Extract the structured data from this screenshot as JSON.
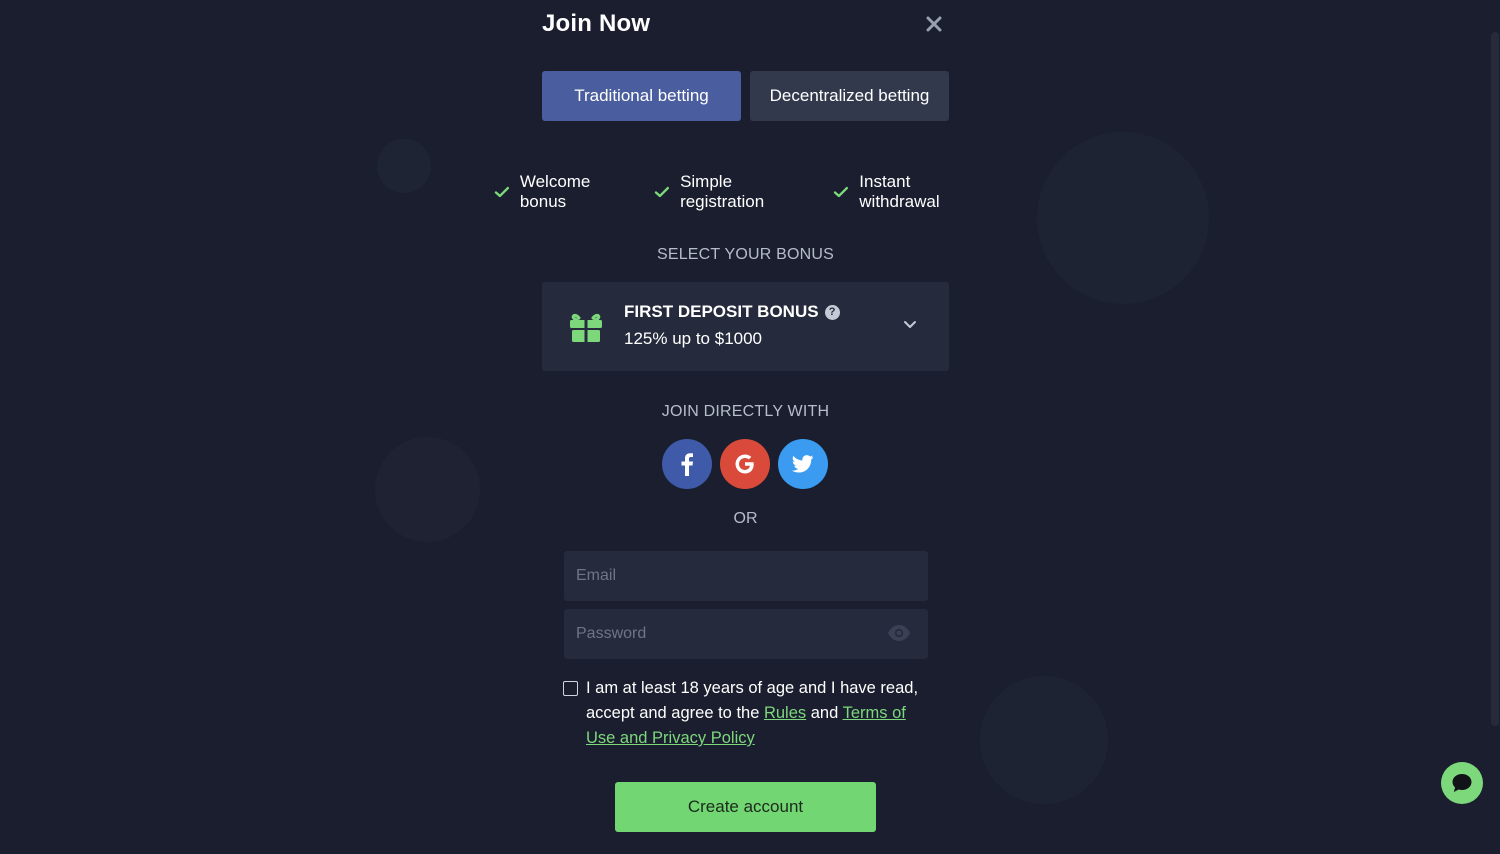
{
  "modal": {
    "title": "Join Now",
    "tabs": [
      {
        "label": "Traditional betting",
        "active": true
      },
      {
        "label": "Decentralized betting",
        "active": false
      }
    ],
    "features": [
      "Welcome bonus",
      "Simple registration",
      "Instant withdrawal"
    ],
    "select_bonus_title": "SELECT YOUR BONUS",
    "bonus": {
      "title": "FIRST DEPOSIT BONUS",
      "subtitle": "125% up to $1000"
    },
    "join_directly_title": "JOIN DIRECTLY WITH",
    "social_icons": [
      "facebook-icon",
      "google-icon",
      "twitter-icon"
    ],
    "or_label": "OR",
    "email_placeholder": "Email",
    "password_placeholder": "Password",
    "terms": {
      "text_before": "I am at least 18 years of age and I have read, accept and agree to the ",
      "rules_link": "Rules",
      "text_middle": " and ",
      "terms_link": "Terms of Use and Privacy Policy"
    },
    "create_button": "Create account"
  },
  "colors": {
    "background": "#1a1e2e",
    "tab_active": "#4a5d9e",
    "tab_inactive": "#33394d",
    "accent_green": "#72d672",
    "facebook": "#3f5aa8",
    "google": "#d94a3b",
    "twitter": "#3a9bf0"
  }
}
